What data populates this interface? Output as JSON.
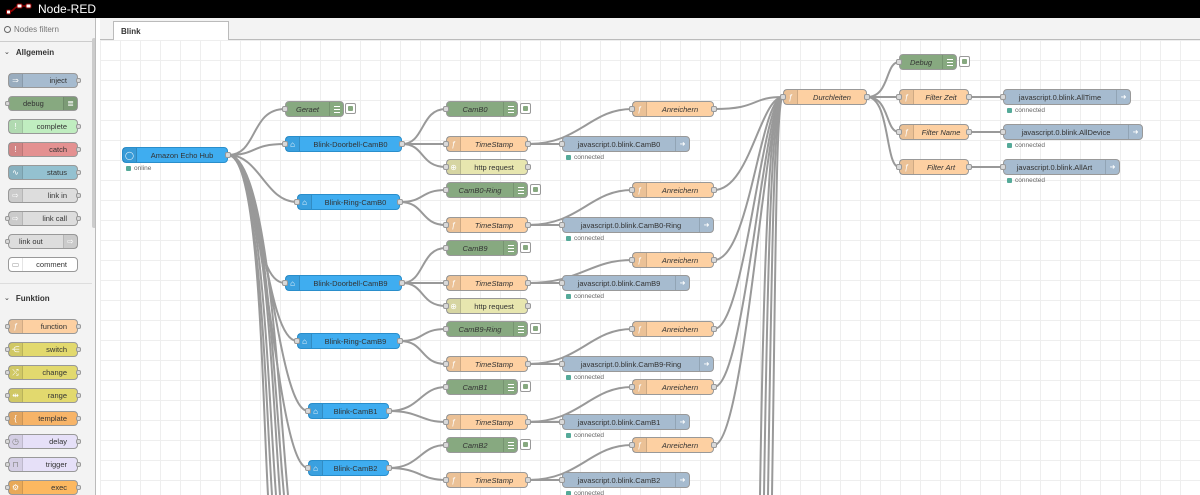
{
  "app": {
    "title": "Node-RED"
  },
  "palette": {
    "search_placeholder": "Nodes filtern",
    "categories": [
      {
        "name": "Allgemein",
        "items": [
          "inject",
          "debug",
          "complete",
          "catch",
          "status",
          "link in",
          "link call",
          "link out",
          "comment"
        ]
      },
      {
        "name": "Funktion",
        "items": [
          "function",
          "switch",
          "change",
          "range",
          "template",
          "delay",
          "trigger",
          "exec"
        ]
      }
    ]
  },
  "tabs": [
    {
      "label": "Blink"
    }
  ],
  "flow": {
    "amazon_hub": {
      "label": "Amazon Echo Hub",
      "status": "online"
    },
    "geraet": "Geraet",
    "blink_doorbell_camb0": "Blink-Doorbell-CamB0",
    "blink_ring_camb0": "Blink-Ring-CamB0",
    "blink_doorbell_camb9": "Blink-Doorbell-CamB9",
    "blink_ring_camb9": "Blink-Ring-CamB9",
    "blink_camb1": "Blink-CamB1",
    "blink_camb2": "Blink-CamB2",
    "camb0": "CamB0",
    "camb0_ring": "CamB0-Ring",
    "camb9": "CamB9",
    "camb9_ring": "CamB9-Ring",
    "camb1": "CamB1",
    "camb2": "CamB2",
    "timestamp": "TimeStamp",
    "http_request": "http request",
    "anreichern": "Anreichern",
    "durchleiten": "Durchleiten",
    "debug": "Debug",
    "filter_zeit": "Filter Zeit",
    "filter_name": "Filter Name",
    "filter_art": "Filter Art",
    "out_camb0": "javascript.0.blink.CamB0",
    "out_camb0_ring": "javascript.0.blink.CamB0-Ring",
    "out_camb9": "javascript.0.blink.CamB9",
    "out_camb9_ring": "javascript.0.blink.CamB9-Ring",
    "out_camb1": "javascript.0.blink.CamB1",
    "out_camb2": "javascript.0.blink.CamB2",
    "out_alltime": "javascript.0.blink.AllTime",
    "out_alldevice": "javascript.0.blink.AllDevice",
    "out_allart": "javascript.0.blink.AllArt",
    "connected": "connected"
  },
  "colors": {
    "header": "#000000",
    "alexa": "#3fadf0",
    "debug": "#87a980",
    "function": "#fdd0a2",
    "http": "#e7e6af",
    "iobroker_out": "#a6bbcf",
    "inject": "#a6bbcf",
    "catch": "#e49191",
    "status": "#94c1d0",
    "switch": "#e2d96e",
    "template": "#f7b468",
    "delay": "#e6e0f8",
    "exec": "#fcb860",
    "comment": "#ffffff",
    "link": "#dddddd"
  }
}
